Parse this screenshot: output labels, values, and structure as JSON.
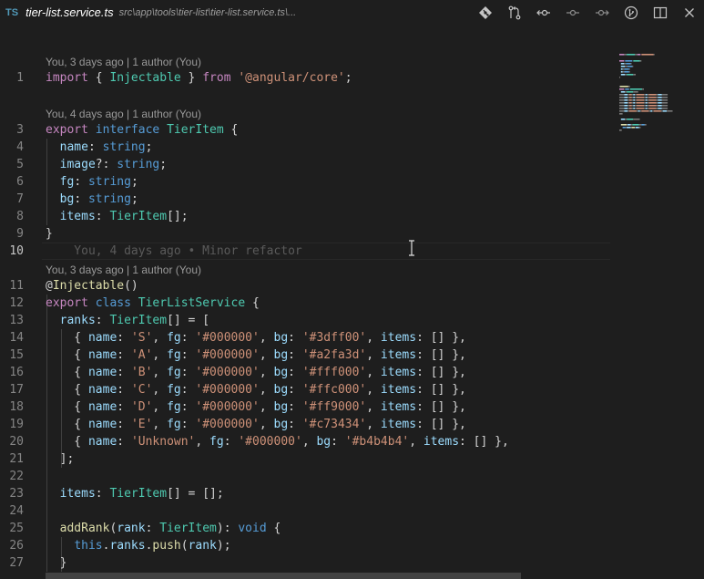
{
  "tab": {
    "lang_badge": "TS",
    "file_name": "tier-list.service.ts",
    "file_path": "src\\app\\tools\\tier-list\\tier-list.service.ts\\..."
  },
  "actions": [
    {
      "name": "git-diamond-icon"
    },
    {
      "name": "git-compare-icon"
    },
    {
      "name": "go-back-change-icon"
    },
    {
      "name": "git-commit-icon"
    },
    {
      "name": "go-forward-change-icon"
    },
    {
      "name": "git-branch-history-icon"
    },
    {
      "name": "split-editor-icon"
    },
    {
      "name": "close-icon"
    }
  ],
  "editor": {
    "lenses": [
      {
        "text": "You, 3 days ago | 1 author (You)"
      },
      {
        "text": "You, 4 days ago | 1 author (You)"
      },
      {
        "text": "You, 3 days ago | 1 author (You)"
      }
    ],
    "blame": "You, 4 days ago • Minor refactor",
    "lines": [
      {
        "n": "1",
        "tokens": [
          [
            "kw2",
            "import"
          ],
          [
            "pl",
            " { "
          ],
          [
            "ty",
            "Injectable"
          ],
          [
            "pl",
            " } "
          ],
          [
            "kw2",
            "from"
          ],
          [
            "pl",
            " "
          ],
          [
            "str",
            "'@angular/core'"
          ],
          [
            "pl",
            ";"
          ]
        ]
      },
      {
        "n": "3",
        "tokens": [
          [
            "kw2",
            "export"
          ],
          [
            "pl",
            " "
          ],
          [
            "kw",
            "interface"
          ],
          [
            "pl",
            " "
          ],
          [
            "ty",
            "TierItem"
          ],
          [
            "pl",
            " {"
          ]
        ]
      },
      {
        "n": "4",
        "tokens": [
          [
            "pl",
            "  "
          ],
          [
            "prop",
            "name"
          ],
          [
            "pl",
            ": "
          ],
          [
            "kw",
            "string"
          ],
          [
            "pl",
            ";"
          ]
        ]
      },
      {
        "n": "5",
        "tokens": [
          [
            "pl",
            "  "
          ],
          [
            "prop",
            "image"
          ],
          [
            "pl",
            "?: "
          ],
          [
            "kw",
            "string"
          ],
          [
            "pl",
            ";"
          ]
        ]
      },
      {
        "n": "6",
        "tokens": [
          [
            "pl",
            "  "
          ],
          [
            "prop",
            "fg"
          ],
          [
            "pl",
            ": "
          ],
          [
            "kw",
            "string"
          ],
          [
            "pl",
            ";"
          ]
        ]
      },
      {
        "n": "7",
        "tokens": [
          [
            "pl",
            "  "
          ],
          [
            "prop",
            "bg"
          ],
          [
            "pl",
            ": "
          ],
          [
            "kw",
            "string"
          ],
          [
            "pl",
            ";"
          ]
        ]
      },
      {
        "n": "8",
        "tokens": [
          [
            "pl",
            "  "
          ],
          [
            "prop",
            "items"
          ],
          [
            "pl",
            ": "
          ],
          [
            "ty",
            "TierItem"
          ],
          [
            "pl",
            "[];"
          ]
        ]
      },
      {
        "n": "9",
        "tokens": [
          [
            "pl",
            "}"
          ]
        ]
      },
      {
        "n": "10",
        "tokens": []
      },
      {
        "n": "11",
        "tokens": [
          [
            "pl",
            "@"
          ],
          [
            "fn",
            "Injectable"
          ],
          [
            "pl",
            "()"
          ]
        ]
      },
      {
        "n": "12",
        "tokens": [
          [
            "kw2",
            "export"
          ],
          [
            "pl",
            " "
          ],
          [
            "kw",
            "class"
          ],
          [
            "pl",
            " "
          ],
          [
            "ty",
            "TierListService"
          ],
          [
            "pl",
            " {"
          ]
        ]
      },
      {
        "n": "13",
        "tokens": [
          [
            "pl",
            "  "
          ],
          [
            "prop",
            "ranks"
          ],
          [
            "pl",
            ": "
          ],
          [
            "ty",
            "TierItem"
          ],
          [
            "pl",
            "[] = ["
          ]
        ]
      },
      {
        "n": "14",
        "tokens": [
          [
            "pl",
            "    { "
          ],
          [
            "prop",
            "name"
          ],
          [
            "pl",
            ": "
          ],
          [
            "str",
            "'S'"
          ],
          [
            "pl",
            ", "
          ],
          [
            "prop",
            "fg"
          ],
          [
            "pl",
            ": "
          ],
          [
            "str",
            "'#000000'"
          ],
          [
            "pl",
            ", "
          ],
          [
            "prop",
            "bg"
          ],
          [
            "pl",
            ": "
          ],
          [
            "str",
            "'#3dff00'"
          ],
          [
            "pl",
            ", "
          ],
          [
            "prop",
            "items"
          ],
          [
            "pl",
            ": [] },"
          ]
        ]
      },
      {
        "n": "15",
        "tokens": [
          [
            "pl",
            "    { "
          ],
          [
            "prop",
            "name"
          ],
          [
            "pl",
            ": "
          ],
          [
            "str",
            "'A'"
          ],
          [
            "pl",
            ", "
          ],
          [
            "prop",
            "fg"
          ],
          [
            "pl",
            ": "
          ],
          [
            "str",
            "'#000000'"
          ],
          [
            "pl",
            ", "
          ],
          [
            "prop",
            "bg"
          ],
          [
            "pl",
            ": "
          ],
          [
            "str",
            "'#a2fa3d'"
          ],
          [
            "pl",
            ", "
          ],
          [
            "prop",
            "items"
          ],
          [
            "pl",
            ": [] },"
          ]
        ]
      },
      {
        "n": "16",
        "tokens": [
          [
            "pl",
            "    { "
          ],
          [
            "prop",
            "name"
          ],
          [
            "pl",
            ": "
          ],
          [
            "str",
            "'B'"
          ],
          [
            "pl",
            ", "
          ],
          [
            "prop",
            "fg"
          ],
          [
            "pl",
            ": "
          ],
          [
            "str",
            "'#000000'"
          ],
          [
            "pl",
            ", "
          ],
          [
            "prop",
            "bg"
          ],
          [
            "pl",
            ": "
          ],
          [
            "str",
            "'#fff000'"
          ],
          [
            "pl",
            ", "
          ],
          [
            "prop",
            "items"
          ],
          [
            "pl",
            ": [] },"
          ]
        ]
      },
      {
        "n": "17",
        "tokens": [
          [
            "pl",
            "    { "
          ],
          [
            "prop",
            "name"
          ],
          [
            "pl",
            ": "
          ],
          [
            "str",
            "'C'"
          ],
          [
            "pl",
            ", "
          ],
          [
            "prop",
            "fg"
          ],
          [
            "pl",
            ": "
          ],
          [
            "str",
            "'#000000'"
          ],
          [
            "pl",
            ", "
          ],
          [
            "prop",
            "bg"
          ],
          [
            "pl",
            ": "
          ],
          [
            "str",
            "'#ffc000'"
          ],
          [
            "pl",
            ", "
          ],
          [
            "prop",
            "items"
          ],
          [
            "pl",
            ": [] },"
          ]
        ]
      },
      {
        "n": "18",
        "tokens": [
          [
            "pl",
            "    { "
          ],
          [
            "prop",
            "name"
          ],
          [
            "pl",
            ": "
          ],
          [
            "str",
            "'D'"
          ],
          [
            "pl",
            ", "
          ],
          [
            "prop",
            "fg"
          ],
          [
            "pl",
            ": "
          ],
          [
            "str",
            "'#000000'"
          ],
          [
            "pl",
            ", "
          ],
          [
            "prop",
            "bg"
          ],
          [
            "pl",
            ": "
          ],
          [
            "str",
            "'#ff9000'"
          ],
          [
            "pl",
            ", "
          ],
          [
            "prop",
            "items"
          ],
          [
            "pl",
            ": [] },"
          ]
        ]
      },
      {
        "n": "19",
        "tokens": [
          [
            "pl",
            "    { "
          ],
          [
            "prop",
            "name"
          ],
          [
            "pl",
            ": "
          ],
          [
            "str",
            "'E'"
          ],
          [
            "pl",
            ", "
          ],
          [
            "prop",
            "fg"
          ],
          [
            "pl",
            ": "
          ],
          [
            "str",
            "'#000000'"
          ],
          [
            "pl",
            ", "
          ],
          [
            "prop",
            "bg"
          ],
          [
            "pl",
            ": "
          ],
          [
            "str",
            "'#c73434'"
          ],
          [
            "pl",
            ", "
          ],
          [
            "prop",
            "items"
          ],
          [
            "pl",
            ": [] },"
          ]
        ]
      },
      {
        "n": "20",
        "tokens": [
          [
            "pl",
            "    { "
          ],
          [
            "prop",
            "name"
          ],
          [
            "pl",
            ": "
          ],
          [
            "str",
            "'Unknown'"
          ],
          [
            "pl",
            ", "
          ],
          [
            "prop",
            "fg"
          ],
          [
            "pl",
            ": "
          ],
          [
            "str",
            "'#000000'"
          ],
          [
            "pl",
            ", "
          ],
          [
            "prop",
            "bg"
          ],
          [
            "pl",
            ": "
          ],
          [
            "str",
            "'#b4b4b4'"
          ],
          [
            "pl",
            ", "
          ],
          [
            "prop",
            "items"
          ],
          [
            "pl",
            ": [] },"
          ]
        ]
      },
      {
        "n": "21",
        "tokens": [
          [
            "pl",
            "  ];"
          ]
        ]
      },
      {
        "n": "22",
        "tokens": []
      },
      {
        "n": "23",
        "tokens": [
          [
            "pl",
            "  "
          ],
          [
            "prop",
            "items"
          ],
          [
            "pl",
            ": "
          ],
          [
            "ty",
            "TierItem"
          ],
          [
            "pl",
            "[] = [];"
          ]
        ]
      },
      {
        "n": "24",
        "tokens": []
      },
      {
        "n": "25",
        "tokens": [
          [
            "pl",
            "  "
          ],
          [
            "fn",
            "addRank"
          ],
          [
            "pl",
            "("
          ],
          [
            "prop",
            "rank"
          ],
          [
            "pl",
            ": "
          ],
          [
            "ty",
            "TierItem"
          ],
          [
            "pl",
            "): "
          ],
          [
            "kw",
            "void"
          ],
          [
            "pl",
            " {"
          ]
        ]
      },
      {
        "n": "26",
        "tokens": [
          [
            "pl",
            "    "
          ],
          [
            "kw",
            "this"
          ],
          [
            "pl",
            "."
          ],
          [
            "prop",
            "ranks"
          ],
          [
            "pl",
            "."
          ],
          [
            "fn",
            "push"
          ],
          [
            "pl",
            "("
          ],
          [
            "prop",
            "rank"
          ],
          [
            "pl",
            ");"
          ]
        ]
      },
      {
        "n": "27",
        "tokens": [
          [
            "pl",
            "  }"
          ]
        ]
      }
    ]
  }
}
